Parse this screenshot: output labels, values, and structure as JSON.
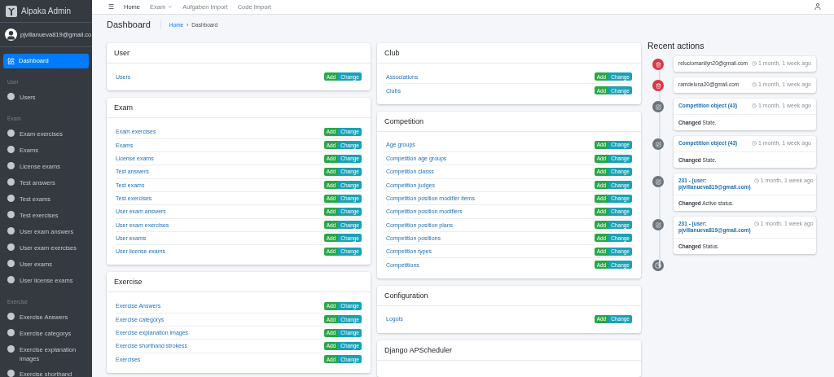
{
  "brand": {
    "title": "Alpaka Admin"
  },
  "sidebar": {
    "user": "pjvillanueva819@gmail.co",
    "items": [
      {
        "label": "Dashboard",
        "selected": true
      }
    ],
    "sections": [
      {
        "header": "User",
        "items": [
          {
            "label": "Users",
            "selected": false
          }
        ]
      },
      {
        "header": "Exam",
        "items": [
          {
            "label": "Exam exercises",
            "selected": false
          },
          {
            "label": "Exams",
            "selected": false
          },
          {
            "label": "License exams",
            "selected": false
          },
          {
            "label": "Test answers",
            "selected": false
          },
          {
            "label": "Test exams",
            "selected": false
          },
          {
            "label": "Test exercises",
            "selected": false
          },
          {
            "label": "User exam answers",
            "selected": false
          },
          {
            "label": "User exam exercises",
            "selected": false
          },
          {
            "label": "User exams",
            "selected": false
          },
          {
            "label": "User license exams",
            "selected": false
          }
        ]
      },
      {
        "header": "Exercise",
        "items": [
          {
            "label": "Exercise Answers",
            "selected": false
          },
          {
            "label": "Exercise categorys",
            "selected": false
          },
          {
            "label": "Exercise explanation images",
            "selected": false
          },
          {
            "label": "Exercise shorthand",
            "selected": false
          }
        ]
      }
    ]
  },
  "navbar": {
    "menu_icon": "☰",
    "links": [
      {
        "label": "Home",
        "selected": true,
        "dropdown": false
      },
      {
        "label": "Exam",
        "selected": false,
        "dropdown": true
      },
      {
        "label": "Aufgaben Import",
        "selected": false,
        "dropdown": false
      },
      {
        "label": "Code Import",
        "selected": false,
        "dropdown": false
      }
    ]
  },
  "header": {
    "title": "Dashboard",
    "breadcrumb": [
      "Home",
      "Dashboard"
    ],
    "separator": "›"
  },
  "columns": [
    [
      {
        "title": "User",
        "rows": [
          {
            "label": "Users",
            "actions": [
              "Add",
              "Change"
            ]
          }
        ]
      },
      {
        "title": "Exam",
        "rows": [
          {
            "label": "Exam exercises",
            "actions": [
              "Add",
              "Change"
            ]
          },
          {
            "label": "Exams",
            "actions": [
              "Add",
              "Change"
            ]
          },
          {
            "label": "License exams",
            "actions": [
              "Add",
              "Change"
            ]
          },
          {
            "label": "Test answers",
            "actions": [
              "Add",
              "Change"
            ]
          },
          {
            "label": "Test exams",
            "actions": [
              "Add",
              "Change"
            ]
          },
          {
            "label": "Test exercises",
            "actions": [
              "Add",
              "Change"
            ]
          },
          {
            "label": "User exam answers",
            "actions": [
              "Add",
              "Change"
            ]
          },
          {
            "label": "User exam exercises",
            "actions": [
              "Add",
              "Change"
            ]
          },
          {
            "label": "User exams",
            "actions": [
              "Add",
              "Change"
            ]
          },
          {
            "label": "User license exams",
            "actions": [
              "Add",
              "Change"
            ]
          }
        ]
      },
      {
        "title": "Exercise",
        "rows": [
          {
            "label": "Exercise Answers",
            "actions": [
              "Add",
              "Change"
            ]
          },
          {
            "label": "Exercise categorys",
            "actions": [
              "Add",
              "Change"
            ]
          },
          {
            "label": "Exercise explanation images",
            "actions": [
              "Add",
              "Change"
            ]
          },
          {
            "label": "Exercise shorthand strokess",
            "actions": [
              "Add",
              "Change"
            ]
          },
          {
            "label": "Exercises",
            "actions": [
              "Add",
              "Change"
            ]
          }
        ]
      }
    ],
    [
      {
        "title": "Club",
        "rows": [
          {
            "label": "Associations",
            "actions": [
              "Add",
              "Change"
            ]
          },
          {
            "label": "Clubs",
            "actions": [
              "Add",
              "Change"
            ]
          }
        ]
      },
      {
        "title": "Competition",
        "rows": [
          {
            "label": "Age groups",
            "actions": [
              "Add",
              "Change"
            ]
          },
          {
            "label": "Competition age groups",
            "actions": [
              "Add",
              "Change"
            ]
          },
          {
            "label": "Competition classs",
            "actions": [
              "Add",
              "Change"
            ]
          },
          {
            "label": "Competition judges",
            "actions": [
              "Add",
              "Change"
            ]
          },
          {
            "label": "Competition position modifier items",
            "actions": [
              "Add",
              "Change"
            ]
          },
          {
            "label": "Competition position modifiers",
            "actions": [
              "Add",
              "Change"
            ]
          },
          {
            "label": "Competition position plans",
            "actions": [
              "Add",
              "Change"
            ]
          },
          {
            "label": "Competition positions",
            "actions": [
              "Add",
              "Change"
            ]
          },
          {
            "label": "Competition types",
            "actions": [
              "Add",
              "Change"
            ]
          },
          {
            "label": "Competitions",
            "actions": [
              "Add",
              "Change"
            ]
          }
        ]
      },
      {
        "title": "Configuration",
        "rows": [
          {
            "label": "Logols",
            "actions": [
              "Add",
              "Change"
            ]
          }
        ]
      },
      {
        "title": "Django APScheduler"
      }
    ]
  ],
  "recent_actions": {
    "title": "Recent actions",
    "items": [
      {
        "kind": "deletion",
        "title": "reluciomanilyn20@gmail.com",
        "time": "1 month, 1 week ago"
      },
      {
        "kind": "deletion",
        "title": "ramdeluna20@gmail.com",
        "time": "1 month, 1 week ago"
      },
      {
        "kind": "change",
        "title": "Competition object (43)",
        "time": "1 month, 1 week ago",
        "message": "**Changed** State."
      },
      {
        "kind": "change",
        "title": "Competition object (43)",
        "time": "1 month, 1 week ago",
        "message": "**Changed** State."
      },
      {
        "kind": "change",
        "title": "231 - (user: pjvillanueva819@gmail.com)",
        "time": "1 month, 1 week ago",
        "message": "**Changed** Active status."
      },
      {
        "kind": "change",
        "title": "231 - (user: pjvillanueva819@gmail.com)",
        "time": "1 month, 1 week ago",
        "message": "**Changed** Status."
      }
    ]
  }
}
